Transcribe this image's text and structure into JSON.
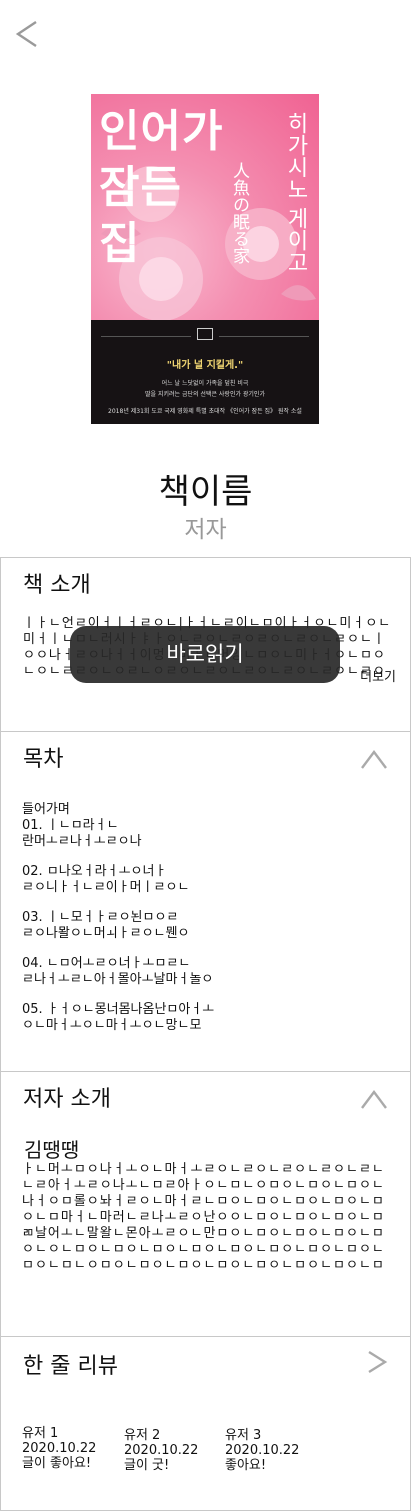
{
  "cover": {
    "title_lines": "인어가\n잠든\n집",
    "author_vertical": "히가시노 게이고",
    "japanese_title": "人魚の眠る家",
    "quote": "\"내가 널 지킬게.\"",
    "tagline_1": "어느 날 느닷없이 가족을 덮친 비극",
    "tagline_2": "딸을 지키려는 금단의 선택은 사랑인가 광기인가",
    "tagline_3": "2018년 제31회 도쿄 국제 영화제 특별 초대작 《인어가 잠든 집》 원작 소설"
  },
  "book": {
    "title": "책이름",
    "author": "저자"
  },
  "intro": {
    "title": "책 소개",
    "text": "ㅣㅏㄴ언ㄹ이ㅓㅣㅓㄹㅇㄴ|ㅏㅓㄴㄹ이ㄴㅁ이ㅏㅓㅇㄴ미ㅓㅇㄴ미ㅓㅣㄴㅁㄴ러시ㅏㅑㅏㅇㄴㄹㅇㄴㄹㅇㄹㅇㄴㄹㅇㄴㄹㅇㄴㅣㅇㅇ나ㅓㄹㅇ나ㅓㅓ이멍ㄴ미ㅏㄴ머잉ㄴㅁㅇㄴ미ㅏㅓㅇㄴㅁㅇㄴㅇㄴㄹㄹㅇㄴㅇㄹㄴㅇㄹㅇㄴㄹㅇㄴㄹㅇㄴㄹㅇㄴㄹㅇㄴㄹㅇㄴㄹㅇㄴㄹㅇㄴㄹㄹㅇㄴㅇㄹㄴㅇㄹㅇㄴㄹㅇㄴㄹㅇㄴㄹㅇㄴㄹㅇㄴㄹㅇㄴㄹ...",
    "more": "더보기"
  },
  "read_button": "바로읽기",
  "toc": {
    "title": "목차",
    "items": [
      {
        "line1": "들어가며",
        "line2": ""
      },
      {
        "line1": "01. ㅣㄴㅁ라ㅓㄴ",
        "line2": "란머ㅗㄹ나ㅓㅗㄹㅇ나"
      },
      {
        "line1": "02. ㅁ나오ㅓ라ㅓㅗㅇ너ㅏ",
        "line2": "ㄹㅇ니ㅏㅓㄴㄹ이ㅏ머ㅣㄹㅇㄴ"
      },
      {
        "line1": "03. ㅣㄴ모ㅓㅏㄹㅇ뇐ㅁㅇㄹ",
        "line2": "ㄹㅇ나뫌ㅇㄴ머ㅚㅏㄹㅇㄴ뭰ㅇ"
      },
      {
        "line1": "04. ㄴㅁ어ㅗㄹㅇ너ㅏㅗㅁㄹㄴ",
        "line2": "ㄹ나ㅓㅗㄹㄴ아ㅓ몰아ㅗ날마ㅓ놀ㅇ"
      },
      {
        "line1": "05. ㅏㅓㅇㄴ몽너몸나옴난ㅁ아ㅓㅗ",
        "line2": "ㅇㄴ마ㅓㅗㅇㄴ마ㅓㅗㅇㄴ망ㄴ모"
      }
    ]
  },
  "author_intro": {
    "title": "저자 소개",
    "name": "김땡땡",
    "text": "ㅏㄴ머ㅗㅁㅇ나ㅓㅗㅇㄴ마ㅓㅗㄹㅇㄴㄹㅇㄴㄹㅇㄴㄹㅇㄴㄹㄴㄴㄹ아ㅓㅗㄹㅇ나ㅗㄴㅁㄹ아ㅏㅇㄴㅁㄴㅇㅁㅇㄴㅁㅇㄴㅁㅇㄴ나ㅓㅇㅁ롤ㅇ놔ㅓㄹㅇㄴ마ㅓㄹㄴㅁㅇㄴㅁㅇㄴㅁㅇㄴㅁㅇㄴㅁㅇㄴㅁ마ㅓㄴ마러ㄴㄹ나ㅗㄹㅇ난ㅇㅇㄴㅁㅇㄴㅁㅇㄴㅁㅇㄴㅁㄻ날어ㅗㄴ말왈ㄴ몬아ㅗㄹㅇㄴ만ㅁㅇㄴㅁㅇㄴㅁㅇㄴㅁㅇㄴㅁㅇㄴㅇㄴㅁㅇㄴㅁㅇㄴㅁㅇㄴㅁㅇㄴㅁㅇㄴㅁㅇㄴㅁㅇㄴㅁㅇㄴㅁㅇㄴㅁㄴㅇㅁㅇㄴㅁㅇㄴㅁㅇㄴㅁㅇㄴㅁㅇㄴㅁㅇㄴㅁㅇㄴㅁㅇㄴㅁㅇㄴㅁㄴ"
  },
  "reviews": {
    "title": "한 줄 리뷰",
    "items": [
      {
        "user": "유저 1",
        "date": "2020.10.22",
        "text": "글이 좋아요!"
      },
      {
        "user": "유저 2",
        "date": "2020.10.22",
        "text": "글이 굿!"
      },
      {
        "user": "유저 3",
        "date": "2020.10.22",
        "text": "좋아요!"
      }
    ]
  }
}
